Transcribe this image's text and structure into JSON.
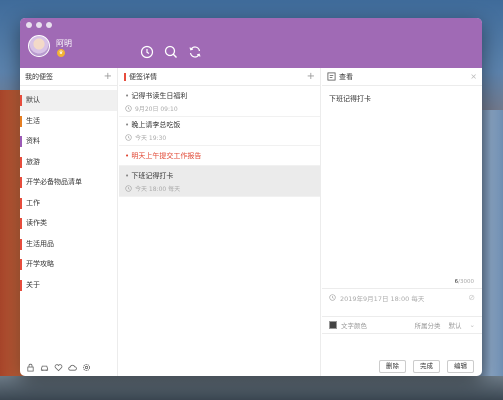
{
  "user": {
    "name": "阿明",
    "badge": "♛"
  },
  "toolbar": {
    "icons": [
      "clock-icon",
      "search-icon",
      "sync-icon"
    ]
  },
  "sidebar": {
    "title": "我的便签",
    "add": "+",
    "items": [
      {
        "label": "默认",
        "color": "#e74c3c",
        "active": true
      },
      {
        "label": "生活",
        "color": "#e67e22"
      },
      {
        "label": "资料",
        "color": "#9b59b6"
      },
      {
        "label": "旅游",
        "color": "#e74c3c"
      },
      {
        "label": "开学必备物品清单",
        "color": "#e74c3c"
      },
      {
        "label": "工作",
        "color": "#e74c3c"
      },
      {
        "label": "读作类",
        "color": "#e74c3c"
      },
      {
        "label": "生活用品",
        "color": "#e74c3c"
      },
      {
        "label": "开学攻略",
        "color": "#e74c3c"
      },
      {
        "label": "关于",
        "color": "#e74c3c"
      }
    ],
    "footer_icons": [
      "lock-icon",
      "car-icon",
      "heart-icon",
      "cloud-icon",
      "settings-icon"
    ]
  },
  "notes": {
    "title": "便签详情",
    "add": "+",
    "items": [
      {
        "title": "记得书读生日福利",
        "meta": "9月20日 09:10",
        "state": "normal"
      },
      {
        "title": "晚上请李总吃饭",
        "meta": "今天 19:30",
        "state": "normal"
      },
      {
        "title": "明天上午提交工作报告",
        "meta": "",
        "state": "red"
      },
      {
        "title": "下班记得打卡",
        "meta": "今天 18:00  每天",
        "state": "selected"
      }
    ]
  },
  "detail": {
    "title": "查看",
    "close": "×",
    "content": "下班记得打卡",
    "char_count_current": "6",
    "char_count_total": "/3000",
    "reminder": "2019年9月17日 18:00 每天",
    "color_label": "文字颜色",
    "category_label": "所属分类",
    "category_value": "默认",
    "buttons": {
      "delete": "删除",
      "done": "完成",
      "edit": "编辑"
    }
  }
}
